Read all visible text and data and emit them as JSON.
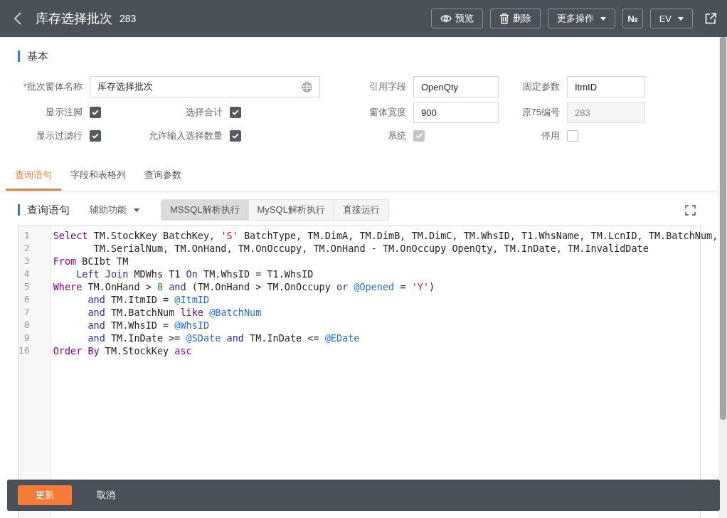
{
  "header": {
    "title": "库存选择批次",
    "number": "283",
    "buttons": [
      {
        "kind": "preview",
        "label": "预览"
      },
      {
        "kind": "delete",
        "label": "删除"
      },
      {
        "kind": "dropdown",
        "label": "更多操作"
      },
      {
        "kind": "text",
        "label": "№"
      },
      {
        "kind": "dropdown",
        "label": "EV"
      },
      {
        "kind": "share"
      }
    ]
  },
  "basic": {
    "title": "基本",
    "fields": [
      {
        "kind": "wide_text",
        "label": "批次窗体名称",
        "required_mark": "*",
        "value": "库存选择批次"
      },
      {
        "kind": "text",
        "label": "引用字段",
        "value": "OpenQty",
        "disabled": false
      },
      {
        "kind": "text",
        "label": "固定参数",
        "value": "ItmID",
        "disabled": false
      },
      {
        "kind": "checkbox",
        "label": "显示注脚",
        "checked": true,
        "disabled": false
      },
      {
        "kind": "checkbox",
        "label": "选择合计",
        "checked": true,
        "disabled": false
      },
      {
        "kind": "text",
        "label": "窗体宽度",
        "value": "900",
        "disabled": false
      },
      {
        "kind": "text",
        "label": "原75编号",
        "value": "283",
        "disabled": true
      },
      {
        "kind": "checkbox",
        "label": "显示过滤行",
        "checked": true,
        "disabled": false
      },
      {
        "kind": "checkbox",
        "label": "允许输入选择数量",
        "checked": true,
        "disabled": false
      },
      {
        "kind": "checkbox",
        "label": "系统",
        "checked": true,
        "disabled": true
      },
      {
        "kind": "checkbox",
        "label": "停用",
        "checked": false,
        "disabled": false
      }
    ]
  },
  "tabs": [
    {
      "label": "查询语句",
      "selected": true
    },
    {
      "label": "字段和表格列",
      "selected": false
    },
    {
      "label": "查询参数",
      "selected": false
    }
  ],
  "query": {
    "title": "查询语句",
    "helper": "辅助功能",
    "modes": [
      {
        "label": "MSSQL解析执行",
        "selected": true
      },
      {
        "label": "MySQL解析执行",
        "selected": false
      },
      {
        "label": "直接运行",
        "selected": false
      }
    ],
    "lines": [
      {
        "number": "1",
        "tokens": [
          {
            "kind": "keyword",
            "t": "Select"
          },
          {
            "kind": "plain",
            "t": " TM.StockKey BatchKey, "
          },
          {
            "kind": "string",
            "t": "'S'"
          },
          {
            "kind": "plain",
            "t": " BatchType, TM.DimA, TM.DimB, TM.DimC, TM.WhsID, T1.WhsName, TM.LcnID, TM.BatchNum,"
          }
        ]
      },
      {
        "number": "2",
        "tokens": [
          {
            "kind": "plain",
            "t": "       TM.SerialNum, TM.OnHand, TM.OnOccupy, TM.OnHand - TM.OnOccupy OpenQty, TM.InDate, TM.InvalidDate"
          }
        ]
      },
      {
        "number": "3",
        "tokens": [
          {
            "kind": "keyword",
            "t": "From"
          },
          {
            "kind": "plain",
            "t": " BCIbt TM"
          }
        ]
      },
      {
        "number": "4",
        "tokens": [
          {
            "kind": "operator",
            "t": "    Left Join"
          },
          {
            "kind": "plain",
            "t": " MDWhs T1 "
          },
          {
            "kind": "operator",
            "t": "On"
          },
          {
            "kind": "plain",
            "t": " TM.WhsID = T1.WhsID"
          }
        ]
      },
      {
        "number": "5",
        "tokens": [
          {
            "kind": "keyword",
            "t": "Where"
          },
          {
            "kind": "plain",
            "t": " TM.OnHand > "
          },
          {
            "kind": "number",
            "t": "0"
          },
          {
            "kind": "operator",
            "t": " and"
          },
          {
            "kind": "plain",
            "t": " (TM.OnHand > TM.OnOccupy "
          },
          {
            "kind": "operator",
            "t": "or"
          },
          {
            "kind": "variable",
            "t": " @Opened"
          },
          {
            "kind": "plain",
            "t": " = "
          },
          {
            "kind": "string",
            "t": "'Y'"
          },
          {
            "kind": "plain",
            "t": ")"
          }
        ]
      },
      {
        "number": "6",
        "tokens": [
          {
            "kind": "operator",
            "t": "      and"
          },
          {
            "kind": "plain",
            "t": " TM.ItmID = "
          },
          {
            "kind": "variable",
            "t": "@ItmID"
          }
        ]
      },
      {
        "number": "7",
        "tokens": [
          {
            "kind": "operator",
            "t": "      and"
          },
          {
            "kind": "plain",
            "t": " TM.BatchNum "
          },
          {
            "kind": "keyword",
            "t": "like"
          },
          {
            "kind": "variable",
            "t": " @BatchNum"
          }
        ]
      },
      {
        "number": "8",
        "tokens": [
          {
            "kind": "operator",
            "t": "      and"
          },
          {
            "kind": "plain",
            "t": " TM.WhsID = "
          },
          {
            "kind": "variable",
            "t": "@WhsID"
          }
        ]
      },
      {
        "number": "9",
        "tokens": [
          {
            "kind": "operator",
            "t": "      and"
          },
          {
            "kind": "plain",
            "t": " TM.InDate >= "
          },
          {
            "kind": "variable",
            "t": "@SDate"
          },
          {
            "kind": "operator",
            "t": " and"
          },
          {
            "kind": "plain",
            "t": " TM.InDate <= "
          },
          {
            "kind": "variable",
            "t": "@EDate"
          }
        ]
      },
      {
        "number": "10",
        "tokens": [
          {
            "kind": "keyword",
            "t": "Order By"
          },
          {
            "kind": "plain",
            "t": " TM.StockKey "
          },
          {
            "kind": "keyword",
            "t": "asc"
          }
        ]
      }
    ]
  },
  "footer": {
    "buttons": [
      {
        "kind": "primary",
        "label": "更新"
      },
      {
        "kind": "plain",
        "label": "取消"
      }
    ]
  }
}
